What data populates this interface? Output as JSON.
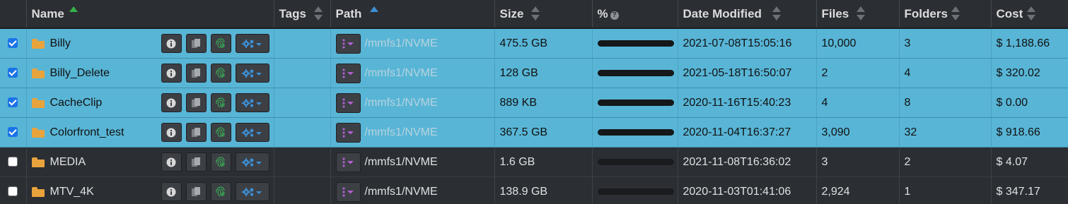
{
  "columns": {
    "name": "Name",
    "tags": "Tags",
    "path": "Path",
    "size": "Size",
    "pct": "%",
    "date": "Date Modified",
    "files": "Files",
    "folders": "Folders",
    "cost": "Cost"
  },
  "colors": {
    "selected_row": "#58b5d6",
    "row": "#2b2e33",
    "folder": "#e8a33d",
    "sort_name": "#35b34a",
    "sort_path": "#3d8fd4"
  },
  "rows": [
    {
      "selected": true,
      "name": "Billy",
      "tags": "",
      "path": "/mmfs1/NVME",
      "size": "475.5 GB",
      "date": "2021-07-08T15:05:16",
      "files": "10,000",
      "folders": "3",
      "cost": "$ 1,188.66"
    },
    {
      "selected": true,
      "name": "Billy_Delete",
      "tags": "",
      "path": "/mmfs1/NVME",
      "size": "128 GB",
      "date": "2021-05-18T16:50:07",
      "files": "2",
      "folders": "4",
      "cost": "$ 320.02"
    },
    {
      "selected": true,
      "name": "CacheClip",
      "tags": "",
      "path": "/mmfs1/NVME",
      "size": "889 KB",
      "date": "2020-11-16T15:40:23",
      "files": "4",
      "folders": "8",
      "cost": "$ 0.00"
    },
    {
      "selected": true,
      "name": "Colorfront_test",
      "tags": "",
      "path": "/mmfs1/NVME",
      "size": "367.5 GB",
      "date": "2020-11-04T16:37:27",
      "files": "3,090",
      "folders": "32",
      "cost": "$ 918.66"
    },
    {
      "selected": false,
      "name": "MEDIA",
      "tags": "",
      "path": "/mmfs1/NVME",
      "size": "1.6 GB",
      "date": "2021-11-08T16:36:02",
      "files": "3",
      "folders": "2",
      "cost": "$ 4.07"
    },
    {
      "selected": false,
      "name": "MTV_4K",
      "tags": "",
      "path": "/mmfs1/NVME",
      "size": "138.9 GB",
      "date": "2020-11-03T01:41:06",
      "files": "2,924",
      "folders": "1",
      "cost": "$ 347.17"
    }
  ]
}
